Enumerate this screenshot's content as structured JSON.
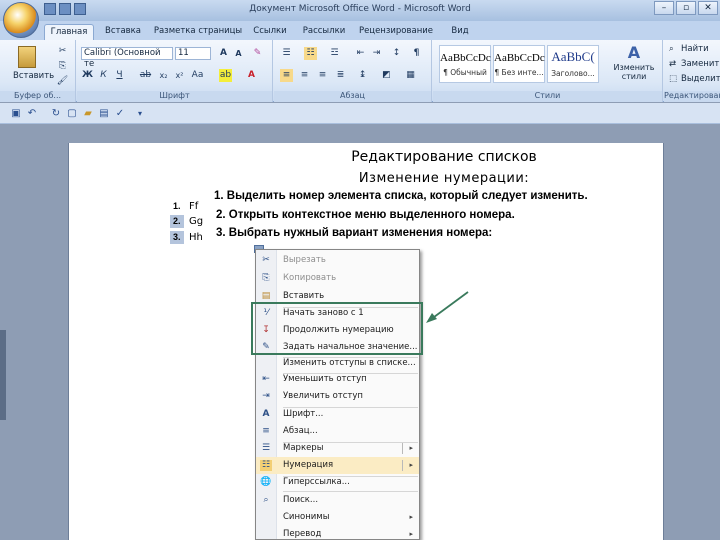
{
  "window": {
    "title": "Документ Microsoft Office Word - Microsoft Word",
    "controls": [
      "–",
      "▫",
      "✕"
    ]
  },
  "tabs": [
    "Главная",
    "Вставка",
    "Разметка страницы",
    "Ссылки",
    "Рассылки",
    "Рецензирование",
    "Вид"
  ],
  "ribbon": {
    "clipboard": {
      "paste_label": "Вставить",
      "group_label": "Буфер об..."
    },
    "font": {
      "font_name": "Calibri (Основной те",
      "font_size": "11",
      "group_label": "Шрифт"
    },
    "paragraph": {
      "group_label": "Абзац"
    },
    "styles": {
      "group_label": "Стили",
      "items": [
        {
          "sample": "AaBbCcDc",
          "name": "¶ Обычный"
        },
        {
          "sample": "AaBbCcDc",
          "name": "¶ Без инте..."
        },
        {
          "sample": "AaBbC(",
          "name": "Заголово..."
        }
      ],
      "change_styles_label": "Изменить стили"
    },
    "editing": {
      "find": "Найти",
      "replace": "Заменить",
      "select": "Выделить",
      "group_label": "Редактирование"
    }
  },
  "document": {
    "heading": "Редактирование списков",
    "subheading": "Изменение нумерации:",
    "instructions": [
      "1. Выделить номер элемента списка, который следует изменить.",
      "2. Открыть контекстное меню выделенного номера.",
      "3. Выбрать нужный вариант изменения номера:"
    ],
    "list": [
      {
        "num": "1.",
        "text": "Ff"
      },
      {
        "num": "2.",
        "text": "Gg"
      },
      {
        "num": "3.",
        "text": "Hh"
      }
    ]
  },
  "context_menu": {
    "items": [
      {
        "label": "Вырезать",
        "icon": "cut-icon",
        "disabled": true
      },
      {
        "label": "Копировать",
        "icon": "copy-icon",
        "disabled": true
      },
      {
        "label": "Вставить",
        "icon": "paste-icon",
        "disabled": false
      },
      {
        "label": "Начать заново с 1",
        "icon": "restart-numbering-icon",
        "disabled": false
      },
      {
        "label": "Продолжить нумерацию",
        "icon": "continue-numbering-icon",
        "disabled": false
      },
      {
        "label": "Задать начальное значение...",
        "icon": "set-value-icon",
        "disabled": false
      },
      {
        "label": "Изменить отступы в списке...",
        "icon": "",
        "disabled": false
      },
      {
        "label": "Уменьшить отступ",
        "icon": "decrease-indent-icon",
        "disabled": false
      },
      {
        "label": "Увеличить отступ",
        "icon": "increase-indent-icon",
        "disabled": false
      },
      {
        "label": "Шрифт...",
        "icon": "font-icon",
        "disabled": false
      },
      {
        "label": "Абзац...",
        "icon": "paragraph-icon",
        "disabled": false
      },
      {
        "label": "Маркеры",
        "icon": "bullets-icon",
        "disabled": false,
        "submenu": true
      },
      {
        "label": "Нумерация",
        "icon": "numbering-icon",
        "disabled": false,
        "submenu": true
      },
      {
        "label": "Гиперссылка...",
        "icon": "hyperlink-icon",
        "disabled": false
      },
      {
        "label": "Поиск...",
        "icon": "search-icon",
        "disabled": false
      },
      {
        "label": "Синонимы",
        "icon": "",
        "disabled": false,
        "submenu": true
      },
      {
        "label": "Перевод",
        "icon": "",
        "disabled": false,
        "submenu": true
      }
    ]
  },
  "colors": {
    "highlight_box": "#3a7a5c",
    "arrow": "#3a7a5c",
    "selection": "#b4c4dc"
  }
}
